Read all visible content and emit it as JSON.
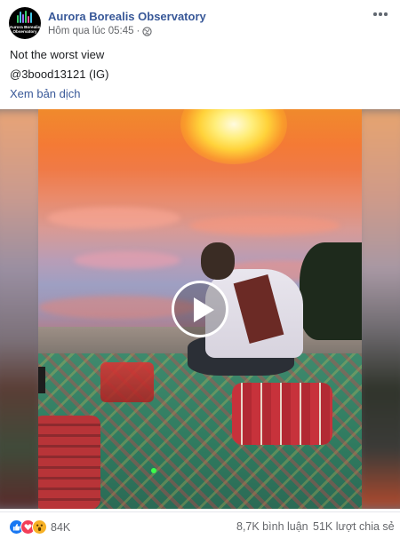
{
  "post": {
    "page_name": "Aurora Borealis Observatory",
    "timestamp": "Hôm qua lúc 05:45",
    "separator": "·",
    "avatar_text": "Aurora Borealis Observatory",
    "privacy_icon": "globe-icon",
    "more_icon": "more-horizontal-icon",
    "caption_lines": [
      "Not the worst view",
      "@3bood13121 (IG)"
    ],
    "translate_link": "Xem bản dịch",
    "video": {
      "play_icon": "play-icon"
    },
    "stats": {
      "reactions": [
        "like-icon",
        "love-icon",
        "wow-icon"
      ],
      "reaction_count": "84K",
      "comments": "8,7K bình luận",
      "shares": "51K lượt chia sẻ"
    }
  },
  "colors": {
    "link": "#385898",
    "meta": "#65676b",
    "like": "#1877f2",
    "love": "#f33e58",
    "wow": "#f7b125"
  }
}
